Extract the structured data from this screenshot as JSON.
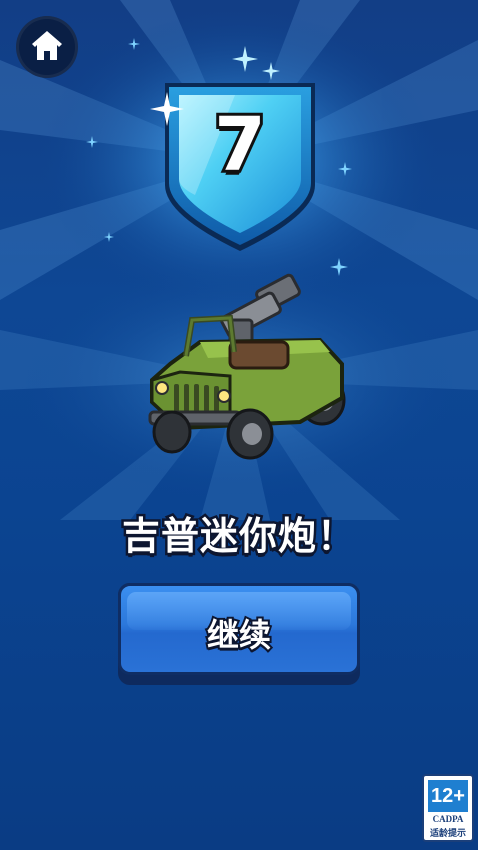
{
  "navigation": {
    "home_icon": "home-icon"
  },
  "reward": {
    "level_badge_value": "7",
    "item_name": "吉普迷你炮！",
    "item_icon": "jeep-mini-cannon-icon"
  },
  "actions": {
    "continue_label": "继续"
  },
  "age_rating": {
    "age": "12+",
    "org": "CADPA",
    "hint": "适龄提示"
  },
  "colors": {
    "background": "#0e4794",
    "badge_gem": "#3fc4ef",
    "button": "#2c78db",
    "jeep_body": "#7aa23a"
  }
}
